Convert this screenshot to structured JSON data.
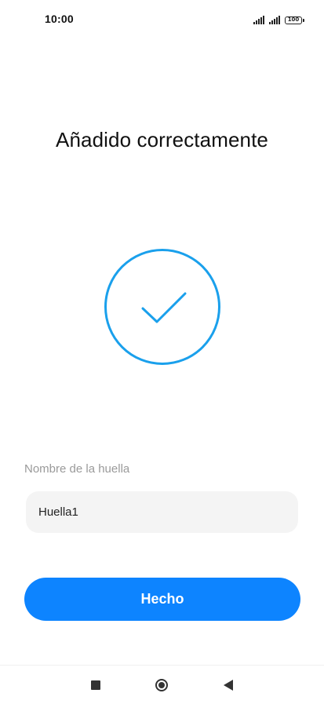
{
  "status_bar": {
    "time": "10:00",
    "battery": "100",
    "icons": [
      "signal-icon",
      "signal-icon",
      "battery-icon"
    ]
  },
  "page": {
    "title": "Añadido correctamente"
  },
  "success_indicator": {
    "icon": "check-circle-icon",
    "color": "#1aa0ec"
  },
  "form": {
    "name_label": "Nombre de la huella",
    "name_value": "Huella1"
  },
  "actions": {
    "done_label": "Hecho",
    "done_color": "#0d84ff"
  },
  "nav_bar": {
    "items": [
      "recents-icon",
      "home-icon",
      "back-icon"
    ]
  }
}
